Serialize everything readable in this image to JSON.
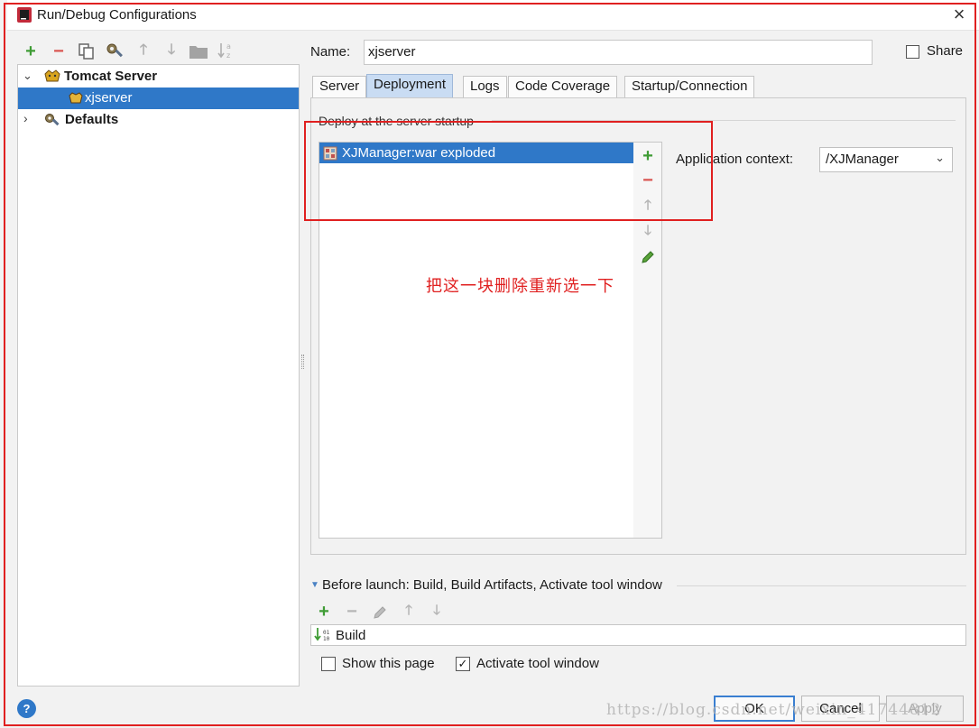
{
  "window": {
    "title": "Run/Debug Configurations",
    "close_glyph": "×"
  },
  "left_toolbar": [
    {
      "name": "add-icon",
      "glyph": "+",
      "color": "#3f9c35"
    },
    {
      "name": "remove-icon",
      "glyph": "−",
      "color": "#d9534f"
    },
    {
      "name": "copy-icon",
      "glyph": "",
      "color": "#6a6a6a"
    },
    {
      "name": "edit-defaults-icon",
      "glyph": "",
      "color": "#7a6a4a"
    },
    {
      "name": "move-up-icon",
      "glyph": "🡑",
      "color": "#b0b0b0"
    },
    {
      "name": "move-down-icon",
      "glyph": "🡓",
      "color": "#b0b0b0"
    },
    {
      "name": "folder-icon",
      "glyph": "",
      "color": "#9a9a9a"
    },
    {
      "name": "sort-icon",
      "glyph": "",
      "color": "#b0b0b0"
    }
  ],
  "tree": {
    "group_label": "Tomcat Server",
    "child_label": "xjserver",
    "defaults_label": "Defaults"
  },
  "name_field": {
    "label": "Name:",
    "value": "xjserver"
  },
  "share": {
    "label": "Share",
    "checked": false
  },
  "tabs": [
    {
      "label": "Server",
      "active": false
    },
    {
      "label": "Deployment",
      "active": true
    },
    {
      "label": "Logs",
      "active": false
    },
    {
      "label": "Code Coverage",
      "active": false
    },
    {
      "label": "Startup/Connection",
      "active": false
    }
  ],
  "deployment": {
    "section_title": "Deploy at the server startup",
    "items": [
      "XJManager:war exploded"
    ],
    "context_label": "Application context:",
    "context_value": "/XJManager"
  },
  "annotation": {
    "text": "把这一块删除重新选一下",
    "color": "#e02020"
  },
  "before_launch": {
    "label": "Before launch: Build, Build Artifacts, Activate tool window",
    "items": [
      "Build"
    ],
    "show_page_label": "Show this page",
    "show_page_checked": false,
    "activate_label": "Activate tool window",
    "activate_checked": true
  },
  "buttons": {
    "help": "?",
    "ok": "OK",
    "cancel": "Cancel",
    "apply": "Apply"
  },
  "watermark": "https://blog.csdn.net/weixin_41744812",
  "colors": {
    "selection": "#2f78c8",
    "annotation_red": "#e02020",
    "add_green": "#3f9c35",
    "remove_red": "#d9534f"
  }
}
